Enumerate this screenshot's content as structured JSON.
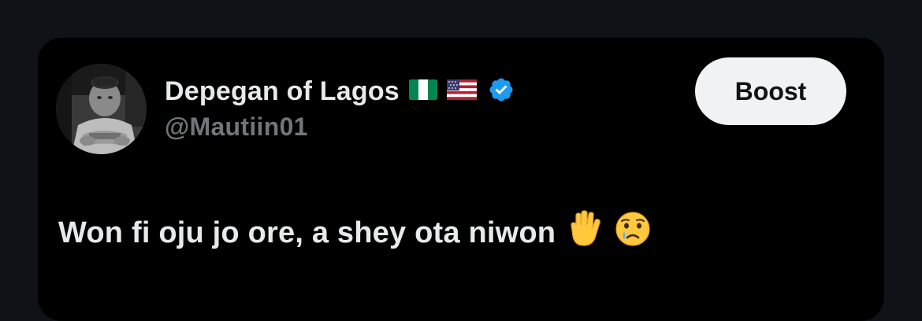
{
  "post": {
    "author": {
      "display_name": "Depegan of Lagos",
      "handle": "@Mautiin01",
      "flags": [
        "nigeria-flag",
        "usa-flag"
      ],
      "verified": true,
      "avatar": "profile-photo-grayscale"
    },
    "boost_label": "Boost",
    "text": "Won fi oju jo ore, a shey ota niwon",
    "emojis": [
      "raised-hand",
      "crying-face"
    ]
  },
  "colors": {
    "page_background": "#0f1216",
    "card_background": "#000000",
    "primary_text": "#e7e9ea",
    "secondary_text": "#71767b",
    "verified_blue": "#1d9bf0",
    "button_background": "#eff3f4",
    "button_text": "#0f1419"
  }
}
